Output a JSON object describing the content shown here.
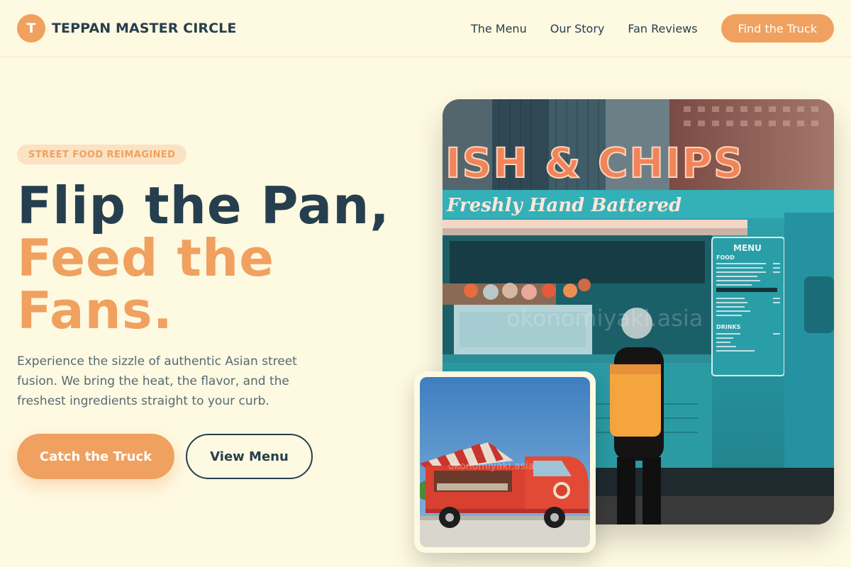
{
  "brand": {
    "initial": "T",
    "name": "TEPPAN MASTER CIRCLE",
    "accent": "#f0a15f",
    "dark": "#263f4e"
  },
  "nav": {
    "links": [
      "The Menu",
      "Our Story",
      "Fan Reviews"
    ],
    "cta": "Find the Truck"
  },
  "hero": {
    "badge": "STREET FOOD REIMAGINED",
    "headline_line1": "Flip the Pan,",
    "headline_line2": "Feed the",
    "headline_line3": "Fans.",
    "lead": "Experience the sizzle of authentic Asian street fusion. We bring the heat, the flavor, and the freshest ingredients straight to your curb.",
    "primary_button": "Catch the Truck",
    "secondary_button": "View Menu"
  },
  "main_photo": {
    "sign": "ISH & CHIPS",
    "script": "Freshly Hand Battered",
    "menu_title": "MENU",
    "menu_food": "FOOD",
    "menu_drinks": "DRINKS",
    "watermark": "okonomiyaki.asia"
  },
  "small_photo": {
    "watermark": "okonomiyaki.asia"
  }
}
